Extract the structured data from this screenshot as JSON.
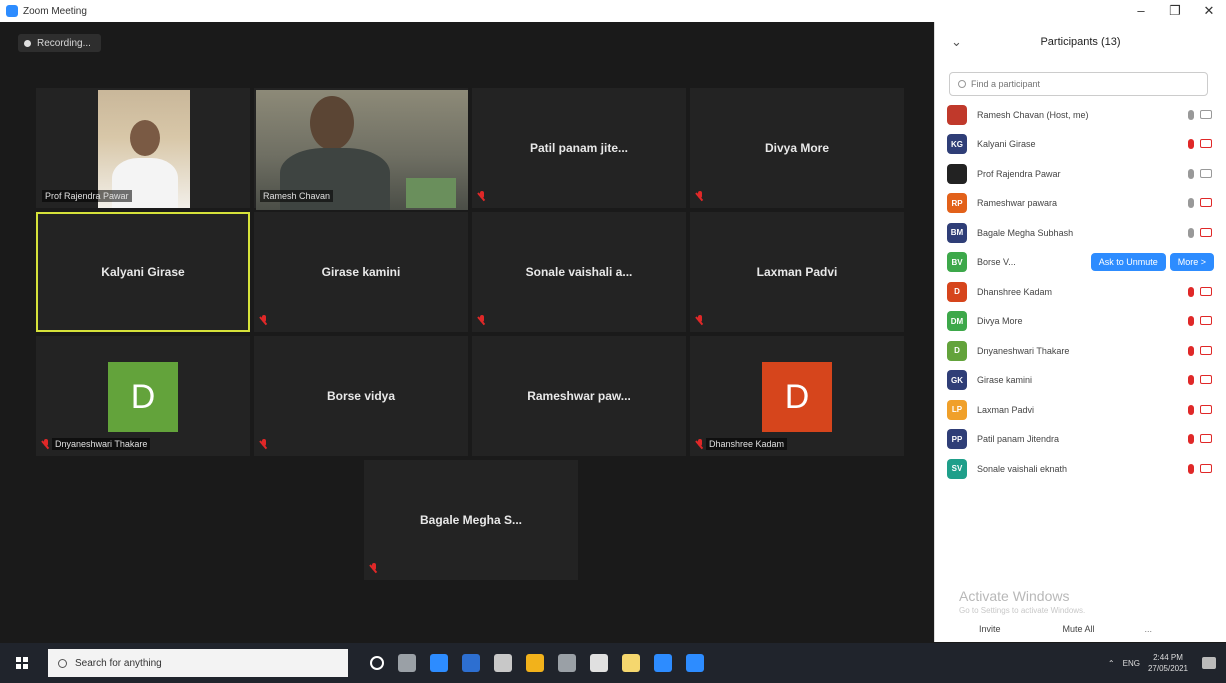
{
  "window": {
    "title": "Zoom Meeting",
    "minimize": "–",
    "maximize": "❐",
    "close": "✕"
  },
  "meeting": {
    "recording_label": "Recording...",
    "tiles": [
      {
        "name": "Prof Rajendra Pawar",
        "kind": "video"
      },
      {
        "name": "Ramesh Chavan",
        "kind": "video"
      },
      {
        "name": "Patil panam jite...",
        "kind": "name"
      },
      {
        "name": "Divya More",
        "kind": "name"
      },
      {
        "name": "Kalyani Girase",
        "kind": "name",
        "active": true
      },
      {
        "name": "Girase kamini",
        "kind": "name"
      },
      {
        "name": "Sonale vaishali a...",
        "kind": "name"
      },
      {
        "name": "Laxman Padvi",
        "kind": "name"
      },
      {
        "name": "Dnyaneshwari Thakare",
        "kind": "avatar",
        "letter": "D",
        "color": "#63a33b"
      },
      {
        "name": "Borse vidya",
        "kind": "name"
      },
      {
        "name": "Rameshwar paw...",
        "kind": "name"
      },
      {
        "name": "Dhanshree Kadam",
        "kind": "avatar",
        "letter": "D",
        "color": "#d6451c"
      },
      {
        "name": "Bagale Megha S...",
        "kind": "name"
      }
    ]
  },
  "participants": {
    "title": "Participants (13)",
    "search_placeholder": "Find a participant",
    "list": [
      {
        "initials": "",
        "name": "Ramesh Chavan (Host, me)",
        "color": "#c0392b"
      },
      {
        "initials": "KG",
        "name": "Kalyani Girase",
        "color": "#2f3e77"
      },
      {
        "initials": "",
        "name": "Prof Rajendra Pawar",
        "color": "#222222"
      },
      {
        "initials": "RP",
        "name": "Rameshwar pawara",
        "color": "#e2611a"
      },
      {
        "initials": "BM",
        "name": "Bagale Megha Subhash",
        "color": "#2f3e77"
      },
      {
        "initials": "BV",
        "name": "Borse V...",
        "color": "#3da84a"
      },
      {
        "initials": "D",
        "name": "Dhanshree Kadam",
        "color": "#d6451c"
      },
      {
        "initials": "DM",
        "name": "Divya More",
        "color": "#3da84a"
      },
      {
        "initials": "D",
        "name": "Dnyaneshwari Thakare",
        "color": "#63a33b"
      },
      {
        "initials": "GK",
        "name": "Girase kamini",
        "color": "#2f3e77"
      },
      {
        "initials": "LP",
        "name": "Laxman Padvi",
        "color": "#f0a02a"
      },
      {
        "initials": "PP",
        "name": "Patil panam Jitendra",
        "color": "#2f3e77"
      },
      {
        "initials": "SV",
        "name": "Sonale vaishali eknath",
        "color": "#1f9f8a"
      }
    ],
    "hover_actions": {
      "ask_to_unmute": "Ask to Unmute",
      "more": "More >"
    },
    "watermark_title": "Activate Windows",
    "watermark_sub": "Go to Settings to activate Windows.",
    "footer": {
      "invite": "Invite",
      "mute_all": "Mute All",
      "more": "..."
    }
  },
  "taskbar": {
    "search_placeholder": "Search for anything",
    "tray_lang": "ENG",
    "time": "2:44 PM",
    "date": "27/05/2021",
    "app_colors": [
      "#ffffff",
      "#9aa0a6",
      "#2d8cff",
      "#2d6fd1",
      "#c8c8c8",
      "#f2b21b",
      "#9aa0a6",
      "#e0e0e0",
      "#f5d76e",
      "#2d8cff",
      "#2d8cff"
    ]
  }
}
